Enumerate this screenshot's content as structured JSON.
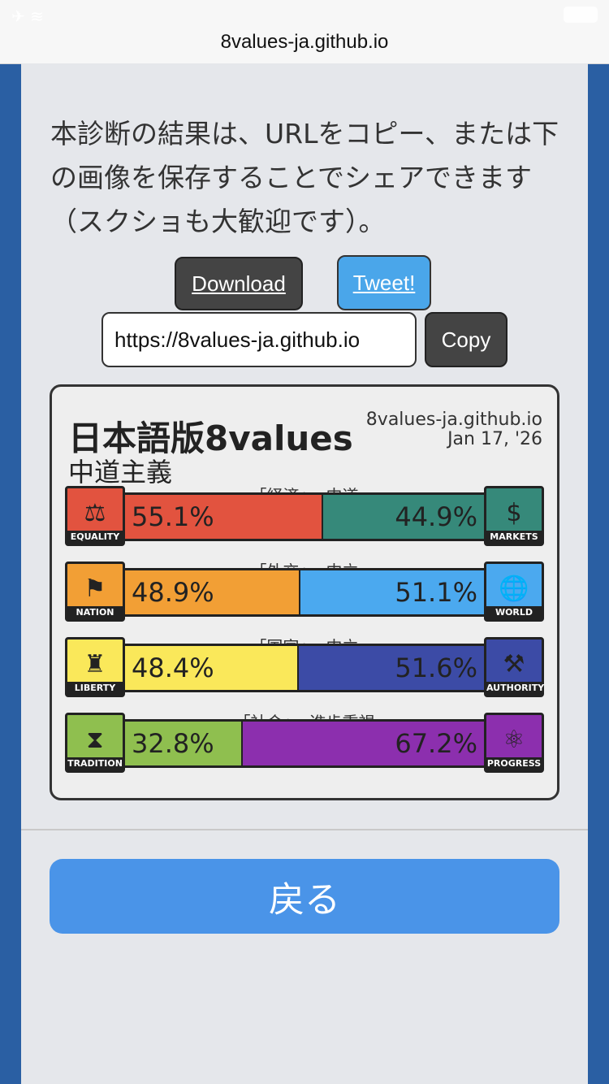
{
  "browser": {
    "url": "8values-ja.github.io"
  },
  "intro": {
    "text": "本診断の結果は、URLをコピー、または下の画像を保存することでシェアできます（スクショも大歓迎です）。"
  },
  "actions": {
    "download_label": "Download",
    "tweet_label": "Tweet!",
    "url_value": "https://8values-ja.github.io",
    "copy_label": "Copy"
  },
  "card": {
    "title": "日本語版8values",
    "ideology": "中道主義",
    "site": "8values-ja.github.io",
    "date": "Jan 17, '26",
    "axes": [
      {
        "label": "「経済」: 中道",
        "left_name": "EQUALITY",
        "right_name": "MARKETS",
        "left_value": "55.1%",
        "right_value": "44.9%",
        "left_pct": 55.1,
        "left_color": "#e2533f",
        "right_color": "#36897a",
        "left_icon": "scales-icon",
        "right_icon": "dollar-icon"
      },
      {
        "label": "「外交」: 中立",
        "left_name": "NATION",
        "right_name": "WORLD",
        "left_value": "48.9%",
        "right_value": "51.1%",
        "left_pct": 48.9,
        "left_color": "#f29f35",
        "right_color": "#4ba9ef",
        "left_icon": "flag-icon",
        "right_icon": "globe-icon"
      },
      {
        "label": "「国家」: 中立",
        "left_name": "LIBERTY",
        "right_name": "AUTHORITY",
        "left_value": "48.4%",
        "right_value": "51.6%",
        "left_pct": 48.4,
        "left_color": "#fae85a",
        "right_color": "#3c4ba6",
        "left_icon": "statue-of-liberty-icon",
        "right_icon": "gavel-icon"
      },
      {
        "label": "「社会」: 進歩重視",
        "left_name": "TRADITION",
        "right_name": "PROGRESS",
        "left_value": "32.8%",
        "right_value": "67.2%",
        "left_pct": 32.8,
        "left_color": "#8fbf4f",
        "right_color": "#8c2fae",
        "left_icon": "hourglass-icon",
        "right_icon": "atom-icon"
      }
    ]
  },
  "back_label": "戻る"
}
